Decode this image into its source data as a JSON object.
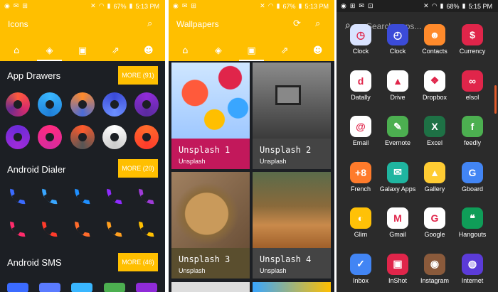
{
  "status": {
    "battery": "67%",
    "time": "5:13 PM",
    "battery3": "68%",
    "time3": "5:15 PM"
  },
  "panel1": {
    "title": "Icons",
    "sections": [
      {
        "label": "App Drawers",
        "more": "MORE (91)"
      },
      {
        "label": "Android Dialer",
        "more": "MORE (20)"
      },
      {
        "label": "Android SMS",
        "more": "MORE (46)"
      }
    ]
  },
  "panel2": {
    "title": "Wallpapers",
    "cards": [
      {
        "title": "Unsplash 1",
        "subtitle": "Unsplash"
      },
      {
        "title": "Unsplash 2",
        "subtitle": "Unsplash"
      },
      {
        "title": "Unsplash 3",
        "subtitle": "Unsplash"
      },
      {
        "title": "Unsplash 4",
        "subtitle": "Unsplash"
      }
    ]
  },
  "panel3": {
    "search_placeholder": "Search apps...",
    "apps": [
      {
        "label": "Clock",
        "color": "#d9e3ff",
        "glyph": "◷"
      },
      {
        "label": "Clock",
        "color": "#3b4bd8",
        "glyph": "◴"
      },
      {
        "label": "Contacts",
        "color": "#ff8a2b",
        "glyph": "☻"
      },
      {
        "label": "Currency",
        "color": "#e0254a",
        "glyph": "$"
      },
      {
        "label": "Datally",
        "color": "#ffffff",
        "glyph": "d"
      },
      {
        "label": "Drive",
        "color": "#ffffff",
        "glyph": "▲"
      },
      {
        "label": "Dropbox",
        "color": "#ffffff",
        "glyph": "❖"
      },
      {
        "label": "elsol",
        "color": "#e0254a",
        "glyph": "∞"
      },
      {
        "label": "Email",
        "color": "#ffffff",
        "glyph": "@"
      },
      {
        "label": "Evernote",
        "color": "#4caf50",
        "glyph": "✎"
      },
      {
        "label": "Excel",
        "color": "#1e7145",
        "glyph": "X"
      },
      {
        "label": "feedly",
        "color": "#4caf50",
        "glyph": "f"
      },
      {
        "label": "French",
        "color": "#ff7b2b",
        "glyph": "+8"
      },
      {
        "label": "Galaxy Apps",
        "color": "#1fb5a0",
        "glyph": "✉"
      },
      {
        "label": "Gallery",
        "color": "#ffcc33",
        "glyph": "▲"
      },
      {
        "label": "Gboard",
        "color": "#4285f4",
        "glyph": "G"
      },
      {
        "label": "Glim",
        "color": "#ffc107",
        "glyph": "◐"
      },
      {
        "label": "Gmail",
        "color": "#ffffff",
        "glyph": "M"
      },
      {
        "label": "Google",
        "color": "#ffffff",
        "glyph": "G"
      },
      {
        "label": "Hangouts",
        "color": "#0f9d58",
        "glyph": "❝"
      },
      {
        "label": "Inbox",
        "color": "#4285f4",
        "glyph": "✓"
      },
      {
        "label": "InShot",
        "color": "#e0254a",
        "glyph": "▣"
      },
      {
        "label": "Instagram",
        "color": "#8a5a3b",
        "glyph": "◉"
      },
      {
        "label": "Internet",
        "color": "#5b3bd8",
        "glyph": "◍"
      }
    ]
  },
  "colors": {
    "accent": "#ffbf00",
    "bg_dark": "#1c1f24"
  }
}
